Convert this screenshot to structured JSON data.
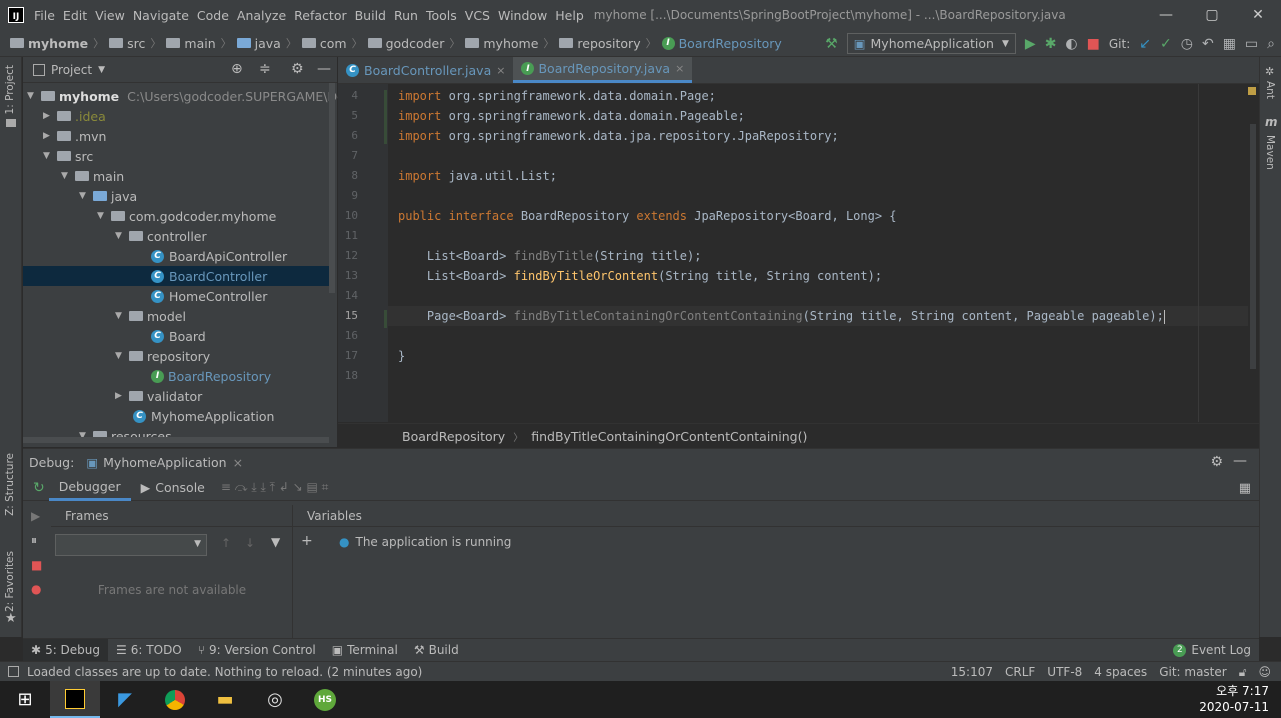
{
  "window": {
    "title": "myhome [...\\Documents\\SpringBootProject\\myhome] - ...\\BoardRepository.java",
    "logo": "IJ",
    "min": "—",
    "max": "▢",
    "close": "✕"
  },
  "menu": [
    "File",
    "Edit",
    "View",
    "Navigate",
    "Code",
    "Analyze",
    "Refactor",
    "Build",
    "Run",
    "Tools",
    "VCS",
    "Window",
    "Help"
  ],
  "breadcrumbs": [
    "myhome",
    "src",
    "main",
    "java",
    "com",
    "godcoder",
    "myhome",
    "repository",
    "BoardRepository"
  ],
  "run_config": "MyhomeApplication",
  "git_label": "Git:",
  "project": {
    "title": "Project",
    "root": "myhome",
    "root_path": "C:\\Users\\godcoder.SUPERGAME\\Doc",
    "items": [
      ".idea",
      ".mvn",
      "src",
      "main",
      "java",
      "com.godcoder.myhome",
      "controller",
      "BoardApiController",
      "BoardController",
      "HomeController",
      "model",
      "Board",
      "repository",
      "BoardRepository",
      "validator",
      "MyhomeApplication",
      "resources"
    ]
  },
  "tabs": [
    {
      "label": "BoardController.java",
      "close": "×"
    },
    {
      "label": "BoardRepository.java",
      "close": "×"
    }
  ],
  "line_numbers": [
    "4",
    "5",
    "6",
    "7",
    "8",
    "9",
    "10",
    "11",
    "12",
    "13",
    "14",
    "15",
    "16",
    "17",
    "18"
  ],
  "code": {
    "l4a": "import",
    "l4b": " org.springframework.data.domain.Page;",
    "l5a": "import",
    "l5b": " org.springframework.data.domain.Pageable;",
    "l6a": "import",
    "l6b": " org.springframework.data.jpa.repository.JpaRepository;",
    "l8a": "import",
    "l8b": " java.util.List;",
    "l10a": "public interface",
    "l10b": " BoardRepository ",
    "l10c": "extends",
    "l10d": " JpaRepository<Board, Long> {",
    "l12a": "    List<Board> ",
    "l12b": "findByTitle",
    "l12c": "(String title);",
    "l13a": "    List<Board> ",
    "l13b": "findByTitleOrContent",
    "l13c": "(String title, String content);",
    "l15a": "    Page<Board> ",
    "l15b": "findByTitleContainingOrContentContaining",
    "l15c": "(String title, String content, Pageable pageable);",
    "l17": "}"
  },
  "editor_breadcrumb": {
    "a": "BoardRepository",
    "sep": "〉",
    "b": "findByTitleContainingOrContentContaining()"
  },
  "debug": {
    "title": "Debug:",
    "config": "MyhomeApplication",
    "close": "×",
    "tab_debugger": "Debugger",
    "tab_console": "Console",
    "frames": "Frames",
    "variables": "Variables",
    "running": "The application is running",
    "frames_na": "Frames are not available"
  },
  "tool_tabs": [
    {
      "label": "5: Debug"
    },
    {
      "label": "6: TODO"
    },
    {
      "label": "9: Version Control"
    },
    {
      "label": "Terminal"
    },
    {
      "label": "Build"
    }
  ],
  "event_log": {
    "count": "2",
    "label": "Event Log"
  },
  "status": {
    "message": "Loaded classes are up to date. Nothing to reload. (2 minutes ago)",
    "pos": "15:107",
    "crlf": "CRLF",
    "enc": "UTF-8",
    "indent": "4 spaces",
    "git": "Git: master"
  },
  "stripes": {
    "project": "1: Project",
    "structure": "Z: Structure",
    "favorites": "2: Favorites",
    "ant": "Ant",
    "maven": "Maven"
  },
  "taskbar": {
    "time": "오후 7:17",
    "date": "2020-07-11",
    "hs": "HS"
  }
}
